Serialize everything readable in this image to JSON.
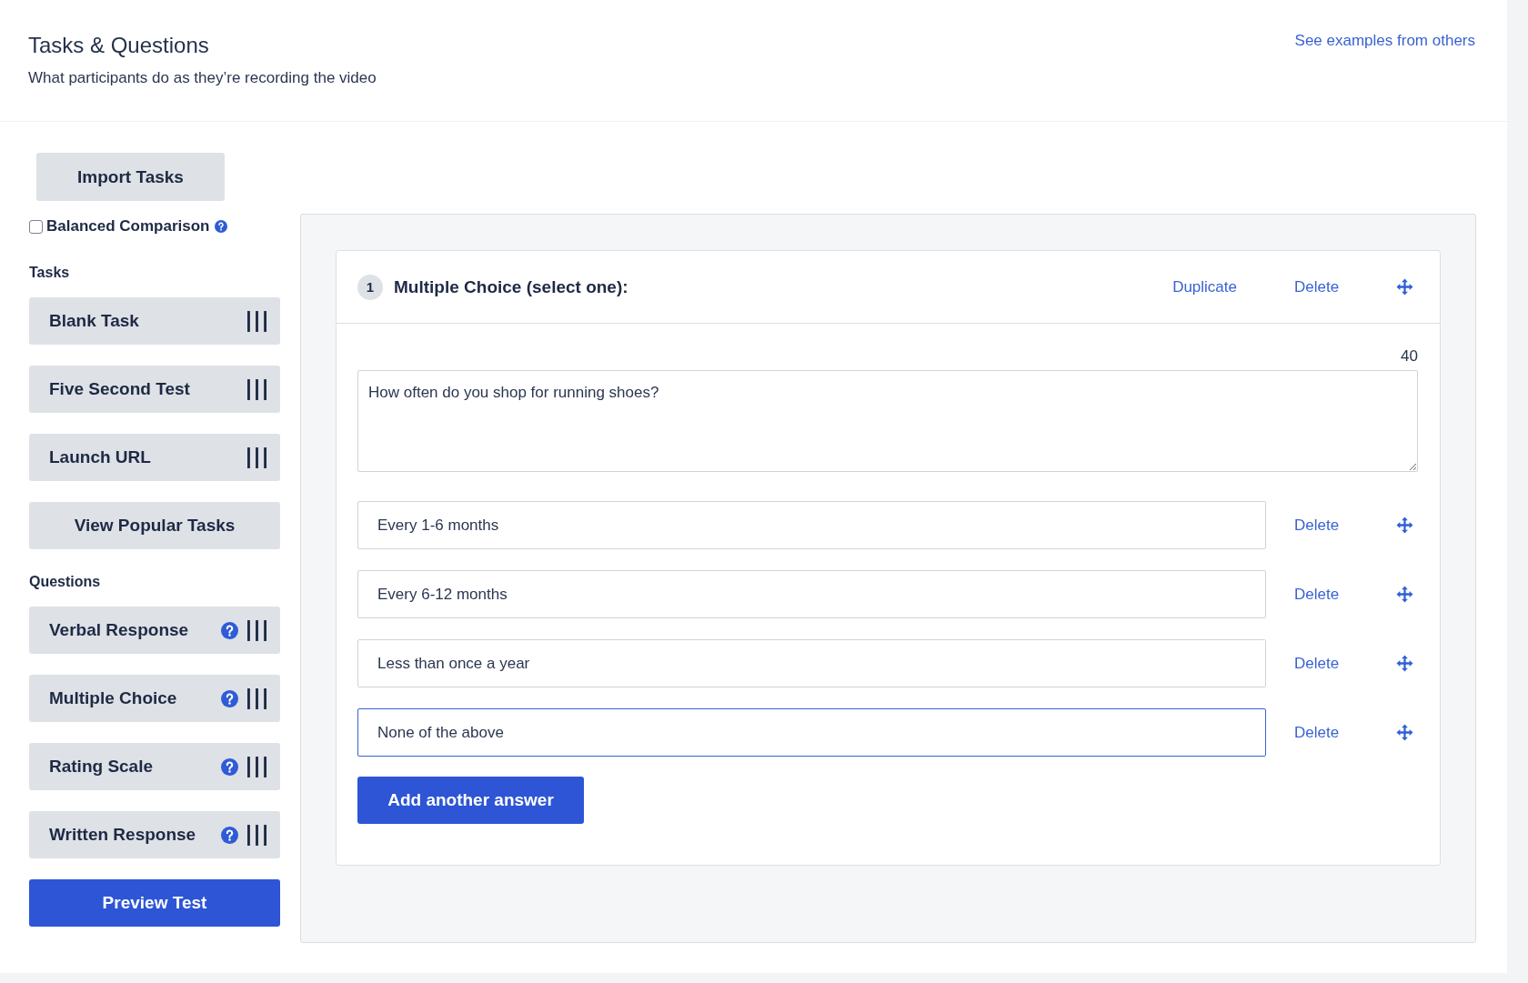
{
  "header": {
    "title": "Tasks & Questions",
    "subtitle": "What participants do as they’re recording the video",
    "link": "See examples from others"
  },
  "sidebar": {
    "import_button": "Import Tasks",
    "balanced_comparison": {
      "label": "Balanced Comparison",
      "checked": false
    },
    "tasks_heading": "Tasks",
    "tasks": [
      {
        "label": "Blank Task"
      },
      {
        "label": "Five Second Test"
      },
      {
        "label": "Launch URL"
      }
    ],
    "popular_button": "View Popular Tasks",
    "questions_heading": "Questions",
    "questions": [
      {
        "label": "Verbal Response"
      },
      {
        "label": "Multiple Choice"
      },
      {
        "label": "Rating Scale"
      },
      {
        "label": "Written Response"
      }
    ],
    "preview_button": "Preview Test"
  },
  "question_card": {
    "number": "1",
    "title": "Multiple Choice (select one):",
    "duplicate": "Duplicate",
    "delete": "Delete",
    "char_count": "40",
    "question_text": "How often do you shop for running shoes?",
    "answers": [
      {
        "value": "Every 1-6 months",
        "delete": "Delete",
        "focused": false
      },
      {
        "value": "Every 6-12 months",
        "delete": "Delete",
        "focused": false
      },
      {
        "value": "Less than once a year",
        "delete": "Delete",
        "focused": false
      },
      {
        "value": "None of the above",
        "delete": "Delete",
        "focused": true
      }
    ],
    "add_button": "Add another answer"
  }
}
